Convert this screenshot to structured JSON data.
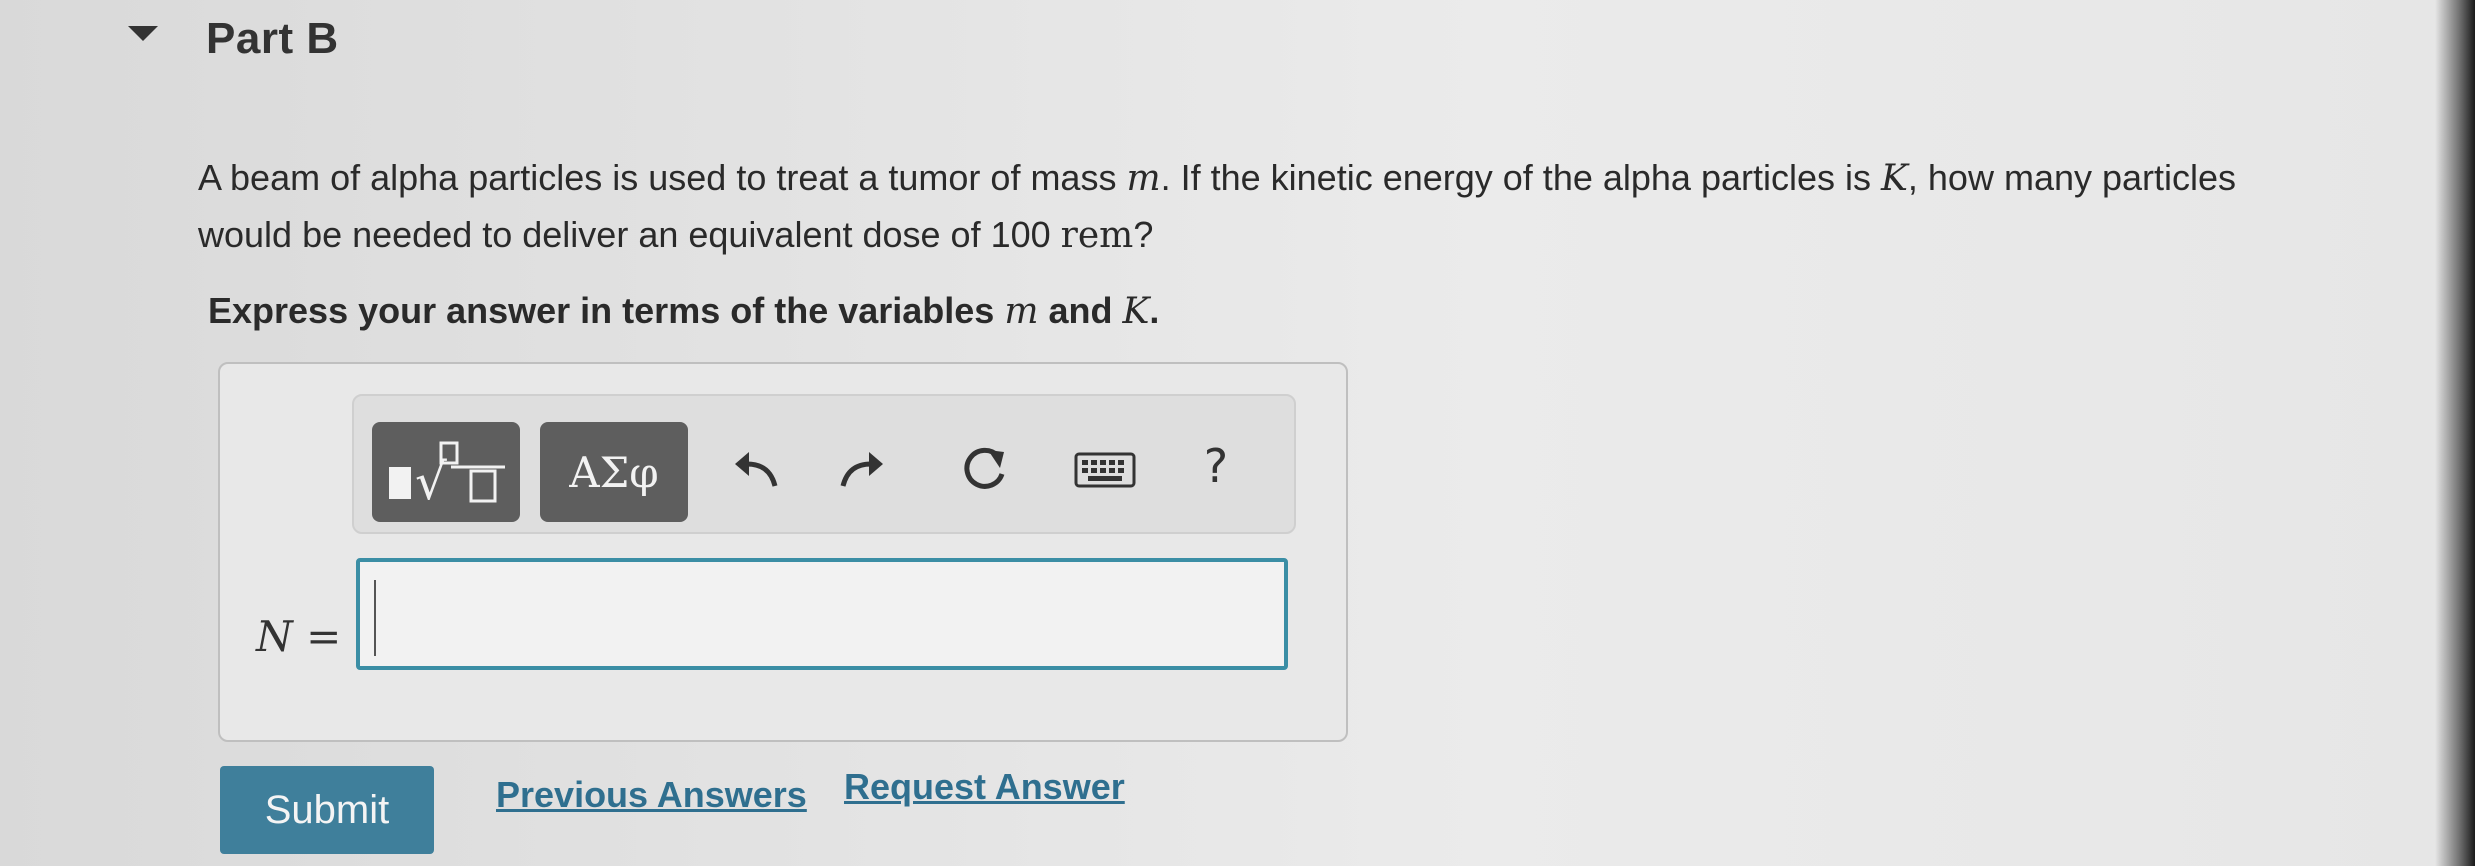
{
  "part": {
    "title": "Part B"
  },
  "question": {
    "text_1": "A beam of alpha particles is used to treat a tumor of mass ",
    "var_m": "m",
    "text_2": ". If the kinetic energy of the alpha particles is ",
    "var_K": "K",
    "text_3": ", how many particles would be needed to deliver an equivalent dose of 100 ",
    "unit": "rem",
    "text_4": "?"
  },
  "instruction": {
    "text_1": "Express your answer in terms of the variables ",
    "var_m": "m",
    "text_2": " and ",
    "var_K": "K",
    "text_3": "."
  },
  "toolbar": {
    "symbols_label": "ΑΣφ",
    "help_label": "?",
    "icons": [
      "templates-icon",
      "undo-icon",
      "redo-icon",
      "reset-icon",
      "keyboard-icon",
      "help-icon"
    ]
  },
  "answer": {
    "variable_label": "N =",
    "value": ""
  },
  "actions": {
    "submit_label": "Submit",
    "previous_answers_label": "Previous Answers",
    "request_answer_label": "Request Answer"
  },
  "colors": {
    "accent": "#3f7f9b",
    "link": "#2f6f8f",
    "input_border": "#3b8ea5",
    "toolbar_button": "#5e5e5e"
  }
}
